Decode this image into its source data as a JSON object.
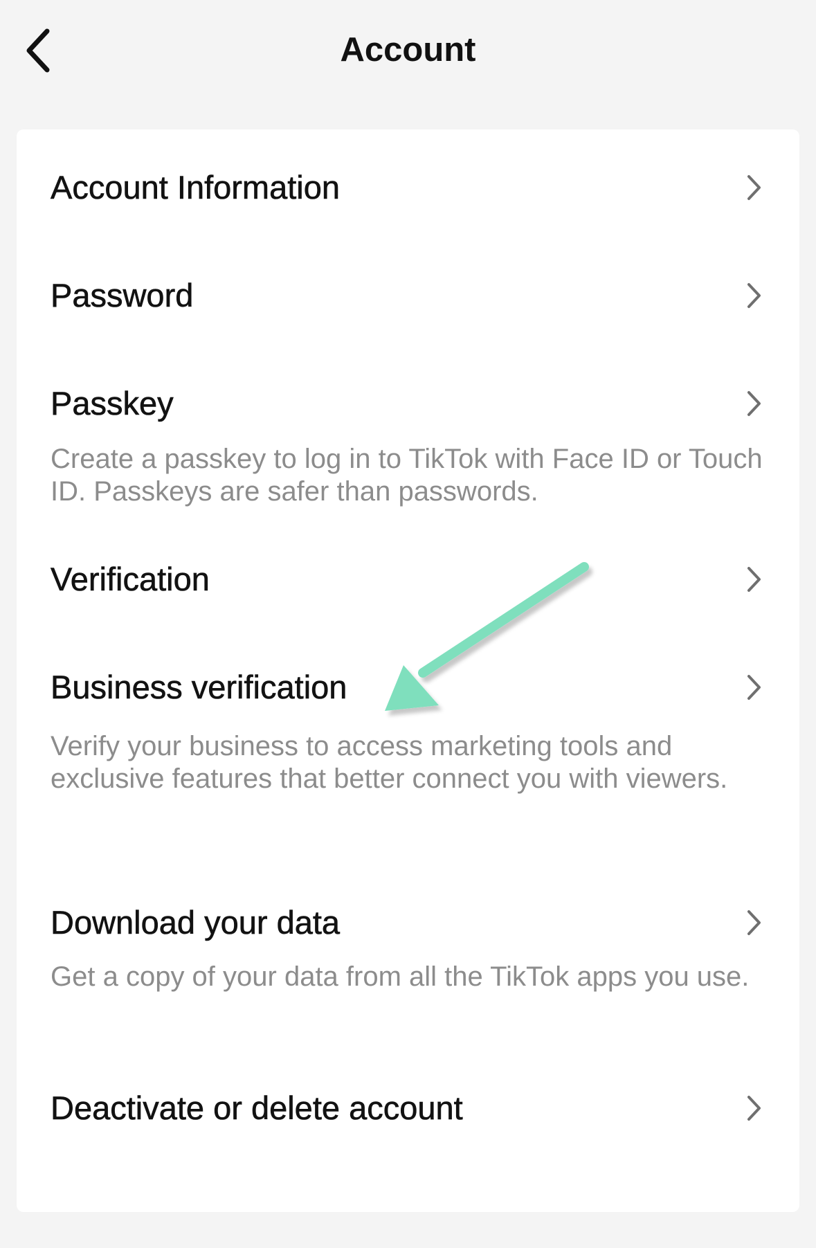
{
  "header": {
    "title": "Account",
    "back_icon": "chevron-left-icon"
  },
  "rows": [
    {
      "title": "Account Information",
      "description": "",
      "icon": "chevron-right-icon"
    },
    {
      "title": "Password",
      "description": "",
      "icon": "chevron-right-icon"
    },
    {
      "title": "Passkey",
      "description": "Create a passkey to log in to TikTok with Face ID or Touch ID. Passkeys are safer than passwords.",
      "icon": "chevron-right-icon"
    },
    {
      "title": "Verification",
      "description": "",
      "icon": "chevron-right-icon"
    },
    {
      "title": "Business verification",
      "description": "Verify your business to access marketing tools and exclusive features that better connect you with viewers.",
      "icon": "chevron-right-icon"
    },
    {
      "title": "Download your data",
      "description": "Get a copy of your data from all the TikTok apps you use.",
      "icon": "chevron-right-icon"
    },
    {
      "title": "Deactivate or delete account",
      "description": "",
      "icon": "chevron-right-icon"
    }
  ],
  "annotation": {
    "icon": "arrow-icon",
    "color": "#7fdfbd"
  },
  "colors": {
    "background": "#f4f4f4",
    "card": "#ffffff",
    "text": "#121212",
    "secondary_text": "#8c8c8c",
    "chevron": "#6f6f6f"
  }
}
